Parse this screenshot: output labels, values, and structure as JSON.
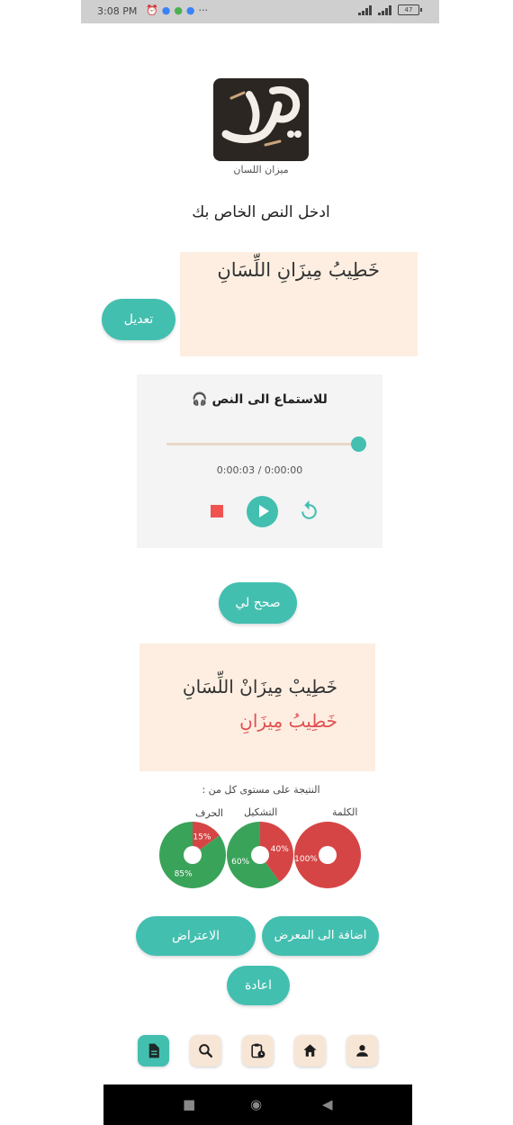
{
  "status_bar": {
    "time": "3:08 PM",
    "left_icons": [
      "alarm-icon",
      "app-icon-blue",
      "app-icon-green",
      "app-icon-blue",
      "more-dots-icon"
    ],
    "more": "···",
    "battery": "47"
  },
  "logo": {
    "calligraphy": "خطيب",
    "subtitle": "ميزان اللسان"
  },
  "prompt": "ادخل النص الخاص بك",
  "input_text": "خَطِيبُ مِيزَانِ اللِّسَانِ",
  "edit_button": "تعديل",
  "audio": {
    "title": "للاستماع الى النص",
    "headphone_icon": "headphones-icon",
    "time": "0:00:03 / 0:00:00",
    "progress": 1.0
  },
  "correct_button": "صحح لي",
  "result": {
    "correct_line": "خَطِيبْ  مِيزَانْ اللِّسَانِ",
    "error_line": "خَطِيبُ مِيزَانِ"
  },
  "levels_label": "النتيجة على مستوى كل من :",
  "chart_data": [
    {
      "type": "pie",
      "title": "الحرف",
      "categories": [
        "correct",
        "incorrect"
      ],
      "values": [
        85,
        15
      ],
      "labels": [
        "85%",
        "15%"
      ],
      "colors": [
        "#3aa35a",
        "#d64545"
      ]
    },
    {
      "type": "pie",
      "title": "التشكيل",
      "categories": [
        "correct",
        "incorrect"
      ],
      "values": [
        60,
        40
      ],
      "labels": [
        "60%",
        "40%"
      ],
      "colors": [
        "#3aa35a",
        "#d64545"
      ]
    },
    {
      "type": "pie",
      "title": "الكلمة",
      "categories": [
        "correct",
        "incorrect"
      ],
      "values": [
        0,
        100
      ],
      "labels": [
        "",
        "100%"
      ],
      "colors": [
        "#3aa35a",
        "#d64545"
      ]
    }
  ],
  "buttons": {
    "objection": "الاعتراض",
    "add_gallery": "اضافة الى المعرض",
    "reset": "اعادة"
  },
  "bottom_nav": [
    "document-icon",
    "search-icon",
    "clipboard-clock-icon",
    "home-icon",
    "person-icon"
  ],
  "colors": {
    "accent": "#43bfb0",
    "panel": "#fdeee1",
    "error": "#e05050"
  }
}
